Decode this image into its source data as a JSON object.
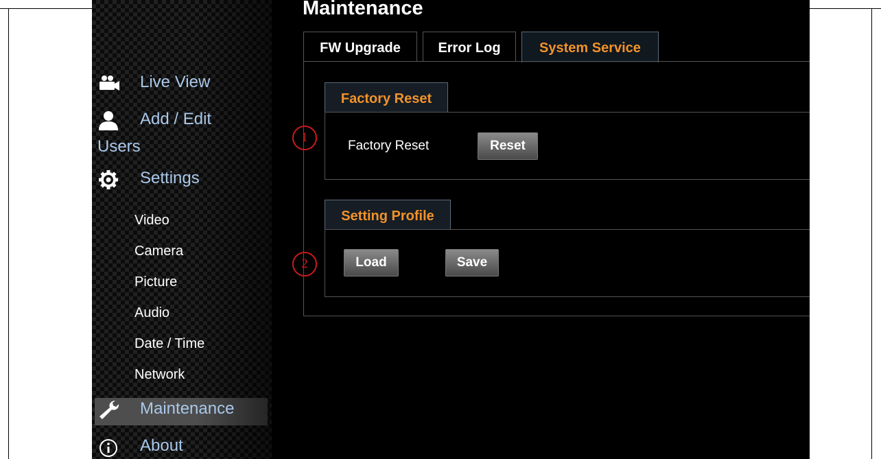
{
  "page_title": "Maintenance",
  "tabs": [
    {
      "label": "FW Upgrade"
    },
    {
      "label": "Error Log"
    },
    {
      "label": "System Service",
      "active": true
    }
  ],
  "sidebar": {
    "items": [
      {
        "label": "Live View",
        "icon": "video-camera-icon"
      },
      {
        "label_line1": "Add / Edit",
        "label_line2": "Users",
        "icon": "user-icon"
      },
      {
        "label": "Settings",
        "icon": "gear-icon"
      },
      {
        "label": "Maintenance",
        "icon": "wrench-icon",
        "active": true
      },
      {
        "label": "About",
        "icon": "info-icon"
      }
    ],
    "settings_sub": [
      "Video",
      "Camera",
      "Picture",
      "Audio",
      "Date / Time",
      "Network"
    ]
  },
  "factory_reset": {
    "section_title": "Factory Reset",
    "field_label": "Factory Reset",
    "button": "Reset"
  },
  "setting_profile": {
    "section_title": "Setting Profile",
    "load_button": "Load",
    "save_button": "Save"
  },
  "callouts": [
    "1",
    "2"
  ],
  "colors": {
    "accent": "#f2922a",
    "nav_text": "#a9c8ea",
    "callout": "#cc1a1a",
    "background": "#000000"
  }
}
